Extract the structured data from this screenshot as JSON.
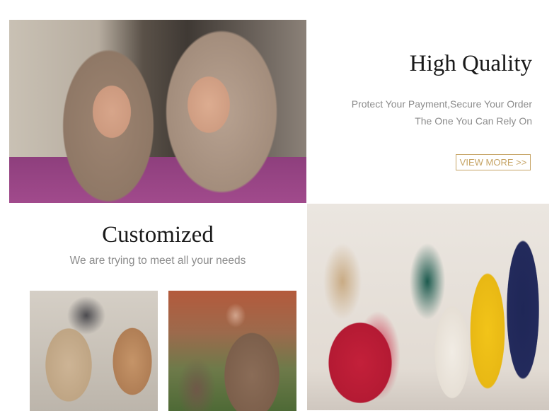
{
  "high_quality": {
    "title": "High Quality",
    "line1": "Protect Your Payment,Secure Your Order",
    "line2": "The One You Can Rely On",
    "button_label": "VIEW MORE >>"
  },
  "customized": {
    "title": "Customized",
    "subtitle": "We are trying to meet all your needs"
  },
  "colors": {
    "accent_gold": "#c6a465",
    "heading_text": "#1a1a1a",
    "muted_text": "#8c8c8c"
  }
}
